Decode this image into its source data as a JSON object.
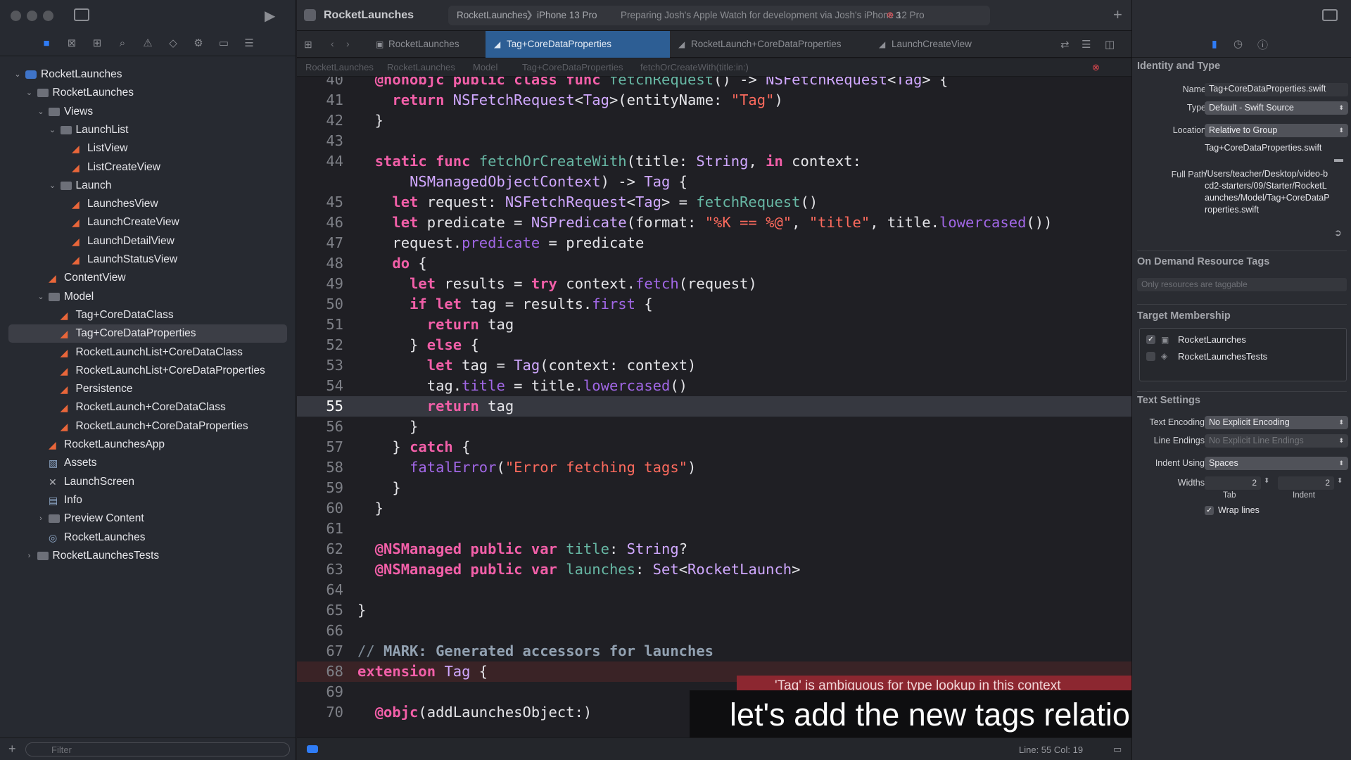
{
  "window": {
    "project_name": "RocketLaunches",
    "scheme": "RocketLaunches",
    "device": "iPhone 13 Pro",
    "activity_status": "Preparing Josh's Apple Watch for development via Josh's iPhone 12 Pro",
    "error_count": "3"
  },
  "tabs": [
    {
      "label": "RocketLaunches",
      "active": false
    },
    {
      "label": "Tag+CoreDataProperties",
      "active": true
    },
    {
      "label": "RocketLaunch+CoreDataProperties",
      "active": false
    },
    {
      "label": "LaunchCreateView",
      "active": false
    }
  ],
  "jump_bar": [
    "RocketLaunches",
    "RocketLaunches",
    "Model",
    "Tag+CoreDataProperties",
    "fetchOrCreateWith(title:in:)"
  ],
  "navigator": {
    "filter_placeholder": "Filter",
    "items": [
      {
        "label": "RocketLaunches",
        "kind": "project",
        "depth": 0,
        "chevron": "open"
      },
      {
        "label": "RocketLaunches",
        "kind": "folder",
        "depth": 1,
        "chevron": "open"
      },
      {
        "label": "Views",
        "kind": "folder",
        "depth": 2,
        "chevron": "open"
      },
      {
        "label": "LaunchList",
        "kind": "folder",
        "depth": 3,
        "chevron": "open"
      },
      {
        "label": "ListView",
        "kind": "swift",
        "depth": 4
      },
      {
        "label": "ListCreateView",
        "kind": "swift",
        "depth": 4
      },
      {
        "label": "Launch",
        "kind": "folder",
        "depth": 3,
        "chevron": "open"
      },
      {
        "label": "LaunchesView",
        "kind": "swift",
        "depth": 4
      },
      {
        "label": "LaunchCreateView",
        "kind": "swift",
        "depth": 4
      },
      {
        "label": "LaunchDetailView",
        "kind": "swift",
        "depth": 4
      },
      {
        "label": "LaunchStatusView",
        "kind": "swift",
        "depth": 4
      },
      {
        "label": "ContentView",
        "kind": "swift",
        "depth": 2
      },
      {
        "label": "Model",
        "kind": "folder",
        "depth": 2,
        "chevron": "open"
      },
      {
        "label": "Tag+CoreDataClass",
        "kind": "swift",
        "depth": 3
      },
      {
        "label": "Tag+CoreDataProperties",
        "kind": "swift",
        "depth": 3,
        "selected": true
      },
      {
        "label": "RocketLaunchList+CoreDataClass",
        "kind": "swift",
        "depth": 3
      },
      {
        "label": "RocketLaunchList+CoreDataProperties",
        "kind": "swift",
        "depth": 3
      },
      {
        "label": "Persistence",
        "kind": "swift",
        "depth": 3
      },
      {
        "label": "RocketLaunch+CoreDataClass",
        "kind": "swift",
        "depth": 3
      },
      {
        "label": "RocketLaunch+CoreDataProperties",
        "kind": "swift",
        "depth": 3
      },
      {
        "label": "RocketLaunchesApp",
        "kind": "swift",
        "depth": 2
      },
      {
        "label": "Assets",
        "kind": "assets",
        "depth": 2
      },
      {
        "label": "LaunchScreen",
        "kind": "xib",
        "depth": 2
      },
      {
        "label": "Info",
        "kind": "plist",
        "depth": 2
      },
      {
        "label": "Preview Content",
        "kind": "folder",
        "depth": 2,
        "chevron": "closed"
      },
      {
        "label": "RocketLaunches",
        "kind": "datamodel",
        "depth": 2
      },
      {
        "label": "RocketLaunchesTests",
        "kind": "folder",
        "depth": 1,
        "chevron": "closed"
      }
    ]
  },
  "code_lines": [
    {
      "n": "40",
      "html": "  <span class=\"at\">@nonobjc</span> <span class=\"kw\">public</span> <span class=\"kw\">class</span> <span class=\"kw\">func</span> <span class=\"fn\">fetchRequest</span>() -> <span class=\"tp\">NSFetchRequest</span><<span class=\"tp\">Tag</span>> {"
    },
    {
      "n": "41",
      "html": "    <span class=\"kw\">return</span> <span class=\"tp\">NSFetchRequest</span><<span class=\"tp\">Tag</span>>(entityName: <span class=\"str\">\"Tag\"</span>)"
    },
    {
      "n": "42",
      "html": "  }"
    },
    {
      "n": "43",
      "html": ""
    },
    {
      "n": "44",
      "html": "  <span class=\"kw\">static</span> <span class=\"kw\">func</span> <span class=\"fn\">fetchOrCreateWith</span>(title: <span class=\"tp\">String</span>, <span class=\"kw\">in</span> context:"
    },
    {
      "n": "",
      "html": "      <span class=\"tp\">NSManagedObjectContext</span>) -> <span class=\"tp\">Tag</span> {"
    },
    {
      "n": "45",
      "html": "    <span class=\"kw\">let</span> request: <span class=\"tp\">NSFetchRequest</span><<span class=\"tp\">Tag</span>> = <span class=\"fn\">fetchRequest</span>()"
    },
    {
      "n": "46",
      "html": "    <span class=\"kw\">let</span> predicate = <span class=\"tp\">NSPredicate</span>(format: <span class=\"str\">\"%K == %@\"</span>, <span class=\"str\">\"title\"</span>, title.<span class=\"prop\">lowercased</span>())"
    },
    {
      "n": "47",
      "html": "    request.<span class=\"prop\">predicate</span> = predicate"
    },
    {
      "n": "48",
      "html": "    <span class=\"kw\">do</span> {"
    },
    {
      "n": "49",
      "html": "      <span class=\"kw\">let</span> results = <span class=\"kw\">try</span> context.<span class=\"prop\">fetch</span>(request)"
    },
    {
      "n": "50",
      "html": "      <span class=\"kw\">if</span> <span class=\"kw\">let</span> tag = results.<span class=\"prop\">first</span> {"
    },
    {
      "n": "51",
      "html": "        <span class=\"kw\">return</span> tag"
    },
    {
      "n": "52",
      "html": "      } <span class=\"kw\">else</span> {"
    },
    {
      "n": "53",
      "html": "        <span class=\"kw\">let</span> tag = <span class=\"tp\">Tag</span>(context: context)"
    },
    {
      "n": "54",
      "html": "        tag.<span class=\"prop\">title</span> = title.<span class=\"prop\">lowercased</span>()"
    },
    {
      "n": "55",
      "html": "        <span class=\"kw\">return</span> tag",
      "current": true
    },
    {
      "n": "56",
      "html": "      }"
    },
    {
      "n": "57",
      "html": "    } <span class=\"kw\">catch</span> {"
    },
    {
      "n": "58",
      "html": "      <span class=\"fn2\">fatalError</span>(<span class=\"str\">\"Error fetching tags\"</span>)"
    },
    {
      "n": "59",
      "html": "    }"
    },
    {
      "n": "60",
      "html": "  }"
    },
    {
      "n": "61",
      "html": ""
    },
    {
      "n": "62",
      "html": "  <span class=\"at\">@NSManaged</span> <span class=\"kw\">public</span> <span class=\"kw\">var</span> <span class=\"fn\">title</span>: <span class=\"tp\">String</span>?"
    },
    {
      "n": "63",
      "html": "  <span class=\"at\">@NSManaged</span> <span class=\"kw\">public</span> <span class=\"kw\">var</span> <span class=\"fn\">launches</span>: <span class=\"tp\">Set</span><<span class=\"tp\">RocketLaunch</span>>"
    },
    {
      "n": "64",
      "html": ""
    },
    {
      "n": "65",
      "html": "}"
    },
    {
      "n": "66",
      "html": ""
    },
    {
      "n": "67",
      "html": "<span class=\"cm\">// </span><span class=\"mark\">MARK: Generated accessors for launches</span>"
    },
    {
      "n": "68",
      "html": "<span class=\"kw\">extension</span> <span class=\"tp\">Tag</span> {",
      "error": true
    },
    {
      "n": "69",
      "html": ""
    },
    {
      "n": "70",
      "html": "  <span class=\"at\">@objc</span>(addLaunchesObject:)"
    }
  ],
  "error_banner": "'Tag' is ambiguous for type lookup in this context",
  "subtitle": "let's add the new tags relationship,",
  "status_bar": {
    "position": "Line: 55  Col: 19"
  },
  "inspector": {
    "identity_title": "Identity and Type",
    "name_label": "Name",
    "name_value": "Tag+CoreDataProperties.swift",
    "type_label": "Type",
    "type_value": "Default - Swift Source",
    "location_label": "Location",
    "location_value": "Relative to Group",
    "location_file": "Tag+CoreDataProperties.swift",
    "fullpath_label": "Full Path",
    "fullpath_value": "/Users/teacher/Desktop/video-bcd2-starters/09/Starter/RocketLaunches/Model/Tag+CoreDataProperties.swift",
    "odr_title": "On Demand Resource Tags",
    "odr_placeholder": "Only resources are taggable",
    "target_title": "Target Membership",
    "targets": [
      {
        "label": "RocketLaunches",
        "checked": true
      },
      {
        "label": "RocketLaunchesTests",
        "checked": false
      }
    ],
    "text_title": "Text Settings",
    "encoding_label": "Text Encoding",
    "encoding_value": "No Explicit Encoding",
    "endings_label": "Line Endings",
    "endings_value": "No Explicit Line Endings",
    "indent_label": "Indent Using",
    "indent_value": "Spaces",
    "widths_label": "Widths",
    "tab_width": "2",
    "indent_width": "2",
    "tab_caption": "Tab",
    "indent_caption": "Indent",
    "wrap_label": "Wrap lines"
  },
  "colors": {
    "accent": "#2f7cf6",
    "error": "#8c2730",
    "selected_tab": "#2d5e94",
    "swift_icon": "#e9663a"
  }
}
